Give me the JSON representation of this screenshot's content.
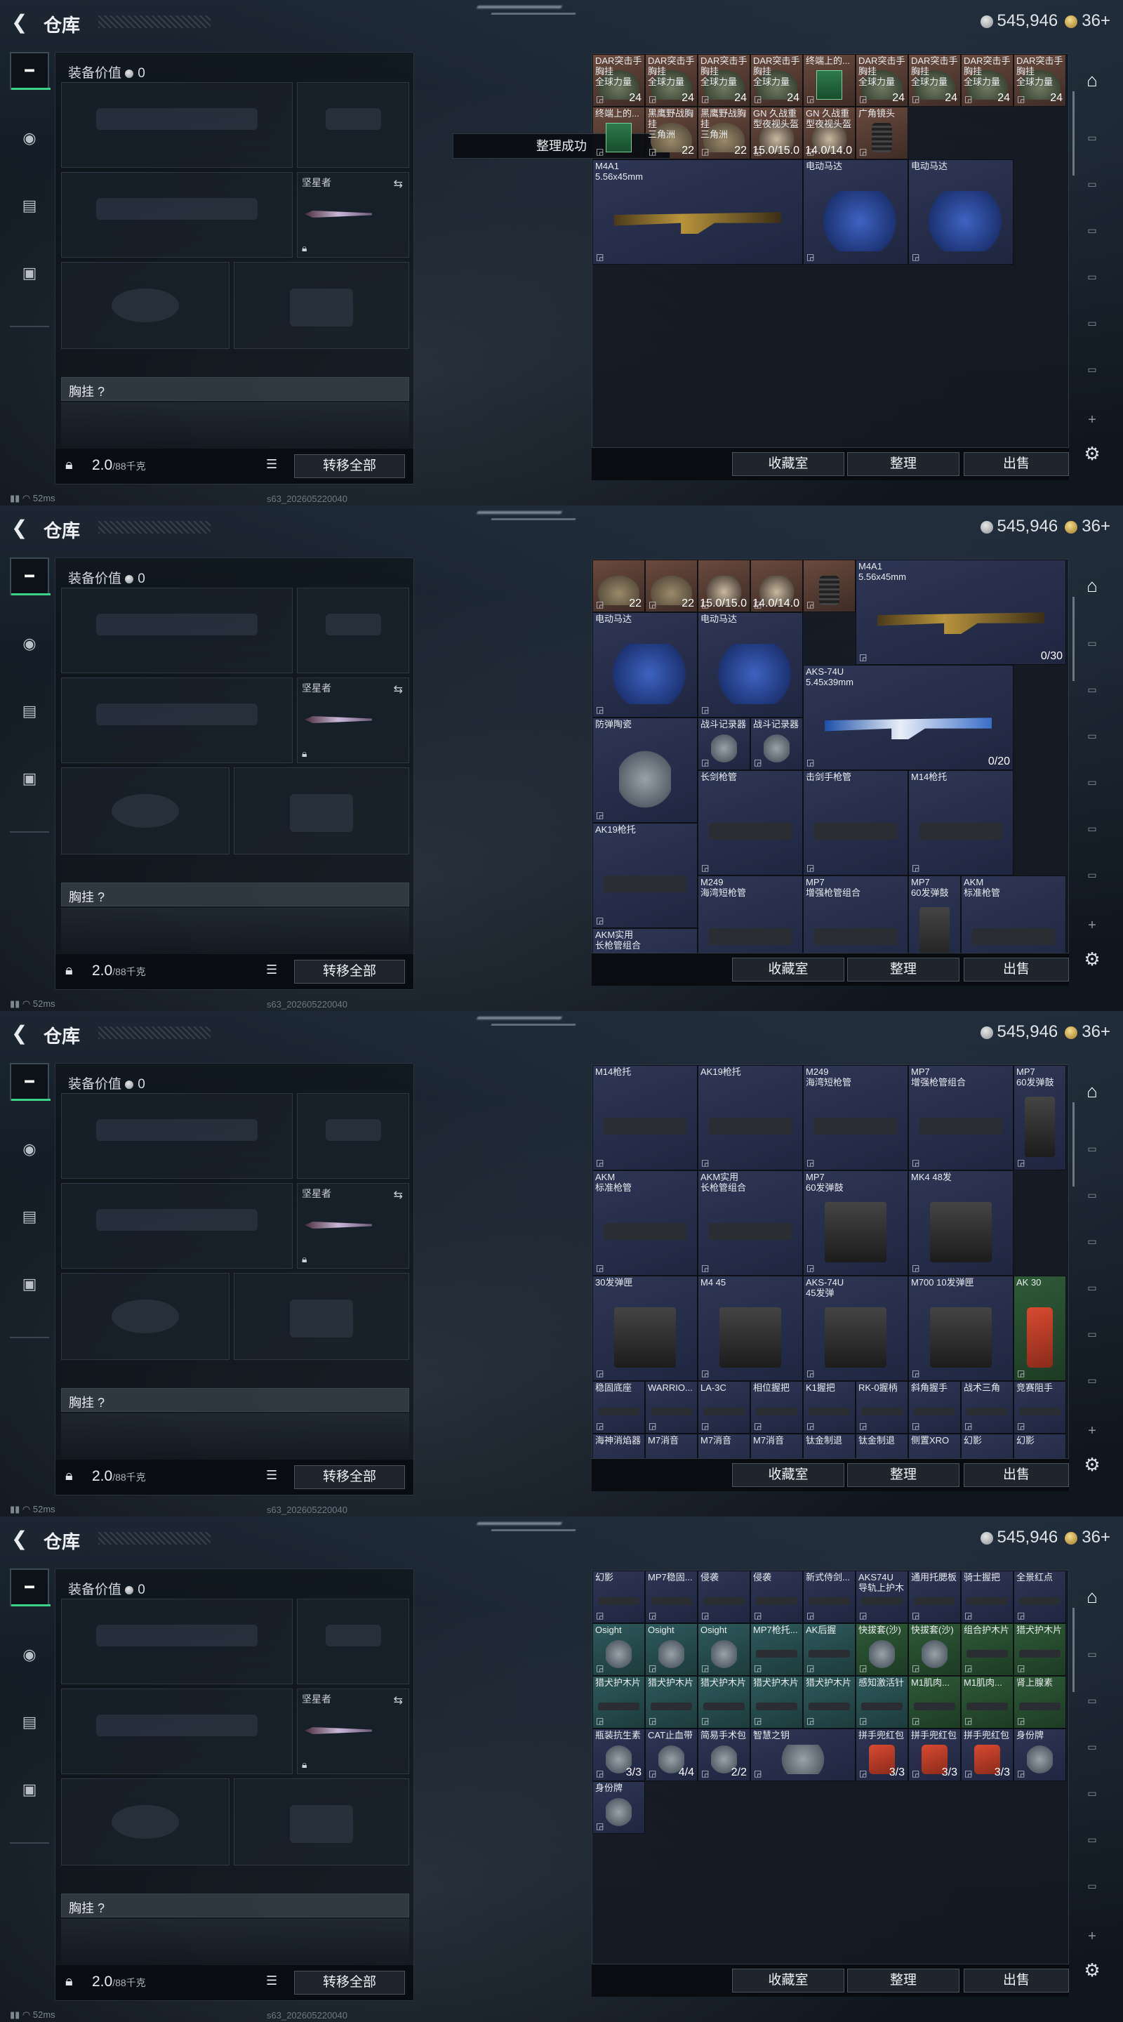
{
  "header": {
    "title": "仓库",
    "silver": "545,946",
    "gold": "36+"
  },
  "equip": {
    "value_label": "装备价值",
    "value": "0",
    "sidearm_label": "坚星者",
    "chest_label": "胸挂",
    "chest_q": "?",
    "weight": "2.0",
    "weight_max": "/88千克",
    "transfer_label": "转移全部"
  },
  "storage_buttons": {
    "collection": "收藏室",
    "sort": "整理",
    "sell": "出售"
  },
  "status": {
    "ping": "52ms",
    "build": "s63_202605220040"
  },
  "toast": "整理成功",
  "panels": [
    {
      "cells": [
        {
          "n": "DAR突击手胸挂\n全球力量",
          "c": "24",
          "k": "brown",
          "p": "bag"
        },
        {
          "n": "DAR突击手胸挂\n全球力量",
          "c": "24",
          "k": "brown",
          "p": "bag"
        },
        {
          "n": "DAR突击手胸挂\n全球力量",
          "c": "24",
          "k": "brown",
          "p": "bag"
        },
        {
          "n": "DAR突击手胸挂\n全球力量",
          "c": "24",
          "k": "brown",
          "p": "bag"
        },
        {
          "n": "终端上的...",
          "c": "",
          "k": "brown",
          "p": "chip"
        },
        {
          "n": "DAR突击手胸挂\n全球力量",
          "c": "24",
          "k": "brown",
          "p": "bag"
        },
        {
          "n": "DAR突击手胸挂\n全球力量",
          "c": "24",
          "k": "brown",
          "p": "bag"
        },
        {
          "n": "DAR突击手胸挂\n全球力量",
          "c": "24",
          "k": "brown",
          "p": "bag"
        },
        {
          "n": "DAR突击手胸挂\n全球力量",
          "c": "24",
          "k": "brown",
          "p": "bag"
        },
        {
          "n": "终端上的...",
          "c": "",
          "k": "brown",
          "p": "chip"
        },
        {
          "n": "黑鹰野战胸挂\n三角洲",
          "c": "22",
          "k": "brown",
          "p": "bag2"
        },
        {
          "n": "黑鹰野战胸挂\n三角洲",
          "c": "22",
          "k": "brown",
          "p": "bag2"
        },
        {
          "n": "GN 久战重型夜视头盔",
          "c": "15.0/15.0",
          "k": "brown",
          "p": "helmet"
        },
        {
          "n": "GN 久战重型夜视头盔",
          "c": "14.0/14.0",
          "k": "brown",
          "p": "helmet"
        },
        {
          "n": "广角镜头",
          "c": "",
          "k": "brown",
          "p": "lens"
        },
        {
          "n": "M4A1\n5.56x45mm",
          "c": "",
          "k": "navy",
          "p": "gungold",
          "span": "big2"
        },
        {
          "n": "电动马达",
          "c": "",
          "k": "navy",
          "p": "motor",
          "span": "wide2"
        },
        {
          "n": "电动马达",
          "c": "",
          "k": "navy",
          "p": "motor",
          "span": "wide2"
        }
      ]
    },
    {
      "cells": [
        {
          "n": "",
          "c": "22",
          "k": "brown",
          "p": "bag2"
        },
        {
          "n": "",
          "c": "22",
          "k": "brown",
          "p": "bag2"
        },
        {
          "n": "",
          "c": "15.0/15.0",
          "k": "brown",
          "p": "helmet"
        },
        {
          "n": "",
          "c": "14.0/14.0",
          "k": "brown",
          "p": "helmet"
        },
        {
          "n": "",
          "c": "",
          "k": "brown",
          "p": "lens"
        },
        {
          "n": "M4A1\n5.56x45mm",
          "c": "0/30",
          "k": "navy",
          "p": "gungold",
          "span": "big2"
        },
        {
          "n": "电动马达",
          "c": "",
          "k": "navy",
          "p": "motor",
          "span": "wide2"
        },
        {
          "n": "电动马达",
          "c": "",
          "k": "navy",
          "p": "motor",
          "span": "wide2"
        },
        {
          "n": "AKS-74U\n5.45x39mm",
          "c": "0/20",
          "k": "navy",
          "p": "gunblue",
          "span": "big2"
        },
        {
          "n": "防弹陶瓷",
          "c": "",
          "k": "navy",
          "p": "item",
          "span": "wide2"
        },
        {
          "n": "战斗记录器",
          "c": "",
          "k": "navy",
          "p": "item"
        },
        {
          "n": "战斗记录器",
          "c": "",
          "k": "navy",
          "p": "item"
        },
        {
          "n": "长剑枪管",
          "c": "",
          "k": "navy",
          "p": "part",
          "span": "wide2"
        },
        {
          "n": "击剑手枪管",
          "c": "",
          "k": "navy",
          "p": "part",
          "span": "wide2"
        },
        {
          "n": "M14枪托",
          "c": "",
          "k": "navy",
          "p": "part",
          "span": "wide2"
        },
        {
          "n": "AK19枪托",
          "c": "",
          "k": "navy",
          "p": "part",
          "span": "wide2"
        },
        {
          "n": "M249\n海湾短枪管",
          "c": "",
          "k": "navy",
          "p": "part",
          "span": "wide2"
        },
        {
          "n": "MP7\n增强枪管组合",
          "c": "",
          "k": "navy",
          "p": "part",
          "span": "wide2"
        },
        {
          "n": "MP7\n60发弹鼓",
          "c": "",
          "k": "navy",
          "p": "mag",
          "span": "tall"
        },
        {
          "n": "AKM\n标准枪管",
          "c": "",
          "k": "navy",
          "p": "part",
          "span": "wide2"
        },
        {
          "n": "AKM实用\n长枪管组合",
          "c": "",
          "k": "navy",
          "p": "part",
          "span": "wide2"
        },
        {
          "n": "MP7\n60发弹鼓",
          "c": "",
          "k": "navy",
          "p": "mag",
          "span": "wide2"
        },
        {
          "n": "MK4 48发",
          "c": "",
          "k": "navy",
          "p": "mag",
          "span": "wide2"
        },
        {
          "n": "30发弹匣",
          "c": "",
          "k": "navy",
          "p": "mag",
          "span": "wide2"
        },
        {
          "n": "M4 45",
          "c": "",
          "k": "navy",
          "p": "mag",
          "span": "wide2"
        },
        {
          "n": "AKS-74U",
          "c": "",
          "k": "navy",
          "p": "mag",
          "span": "wide2"
        },
        {
          "n": "M700 10发弹匣",
          "c": "",
          "k": "navy",
          "p": "mag",
          "span": "wide2"
        },
        {
          "n": "AK 30",
          "c": "",
          "k": "navy",
          "p": "red"
        }
      ]
    },
    {
      "cells": [
        {
          "n": "M14枪托",
          "c": "",
          "k": "navy",
          "p": "part",
          "span": "wide2"
        },
        {
          "n": "AK19枪托",
          "c": "",
          "k": "navy",
          "p": "part",
          "span": "wide2"
        },
        {
          "n": "M249\n海湾短枪管",
          "c": "",
          "k": "navy",
          "p": "part",
          "span": "wide2"
        },
        {
          "n": "MP7\n增强枪管组合",
          "c": "",
          "k": "navy",
          "p": "part",
          "span": "wide2"
        },
        {
          "n": "MP7\n60发弹鼓",
          "c": "",
          "k": "navy",
          "p": "mag",
          "span": "tall"
        },
        {
          "n": "AKM\n标准枪管",
          "c": "",
          "k": "navy",
          "p": "part",
          "span": "wide2"
        },
        {
          "n": "AKM实用\n长枪管组合",
          "c": "",
          "k": "navy",
          "p": "part",
          "span": "wide2"
        },
        {
          "n": "MP7\n60发弹鼓",
          "c": "",
          "k": "navy",
          "p": "mag",
          "span": "wide2"
        },
        {
          "n": "MK4 48发",
          "c": "",
          "k": "navy",
          "p": "mag",
          "span": "wide2"
        },
        {
          "n": "30发弹匣",
          "c": "",
          "k": "navy",
          "p": "mag",
          "span": "wide2"
        },
        {
          "n": "M4 45",
          "c": "",
          "k": "navy",
          "p": "mag",
          "span": "wide2"
        },
        {
          "n": "AKS-74U\n45发弹",
          "c": "",
          "k": "navy",
          "p": "mag",
          "span": "wide2"
        },
        {
          "n": "M700 10发弹匣",
          "c": "",
          "k": "navy",
          "p": "mag",
          "span": "wide2"
        },
        {
          "n": "AK 30",
          "c": "",
          "k": "green",
          "p": "red",
          "span": "tall"
        },
        {
          "n": "稳固底座",
          "c": "",
          "k": "navy",
          "p": "part"
        },
        {
          "n": "WARRIO...",
          "c": "",
          "k": "navy",
          "p": "part"
        },
        {
          "n": "LA-3C",
          "c": "",
          "k": "navy",
          "p": "part"
        },
        {
          "n": "相位握把",
          "c": "",
          "k": "navy",
          "p": "part"
        },
        {
          "n": "K1握把",
          "c": "",
          "k": "navy",
          "p": "part"
        },
        {
          "n": "RK-0握柄",
          "c": "",
          "k": "navy",
          "p": "part"
        },
        {
          "n": "斜角握手",
          "c": "",
          "k": "navy",
          "p": "part"
        },
        {
          "n": "战术三角",
          "c": "",
          "k": "navy",
          "p": "part"
        },
        {
          "n": "竞赛阻手",
          "c": "",
          "k": "navy",
          "p": "part"
        },
        {
          "n": "海神消焰器",
          "c": "",
          "k": "navy",
          "p": "part"
        },
        {
          "n": "M7消音",
          "c": "",
          "k": "navy",
          "p": "part"
        },
        {
          "n": "M7消音",
          "c": "",
          "k": "navy",
          "p": "part"
        },
        {
          "n": "M7消音",
          "c": "",
          "k": "navy",
          "p": "part"
        },
        {
          "n": "钛金制退",
          "c": "",
          "k": "navy",
          "p": "part"
        },
        {
          "n": "钛金制退",
          "c": "",
          "k": "navy",
          "p": "part"
        },
        {
          "n": "侧置XRO",
          "c": "",
          "k": "navy",
          "p": "part"
        },
        {
          "n": "幻影",
          "c": "",
          "k": "navy",
          "p": "part"
        },
        {
          "n": "幻影",
          "c": "",
          "k": "navy",
          "p": "part"
        },
        {
          "n": "MP7稳固...",
          "c": "",
          "k": "navy",
          "p": "part"
        },
        {
          "n": "侵袭",
          "c": "",
          "k": "navy",
          "p": "part"
        },
        {
          "n": "侵袭",
          "c": "",
          "k": "navy",
          "p": "part"
        },
        {
          "n": "新式侍剑...",
          "c": "",
          "k": "navy",
          "p": "part"
        },
        {
          "n": "AKS74U\n导轨上护木",
          "c": "",
          "k": "navy",
          "p": "part"
        },
        {
          "n": "通用托腮板",
          "c": "",
          "k": "navy",
          "p": "part"
        },
        {
          "n": "骑士握把",
          "c": "",
          "k": "navy",
          "p": "tri"
        },
        {
          "n": "全景红点",
          "c": "",
          "k": "navy",
          "p": "tri"
        },
        {
          "n": "Osight",
          "c": "",
          "k": "teal",
          "p": "tri"
        },
        {
          "n": "Osight",
          "c": "",
          "k": "teal",
          "p": "tri"
        },
        {
          "n": "Osight",
          "c": "",
          "k": "teal",
          "p": "tri"
        },
        {
          "n": "MP7枪托...",
          "c": "",
          "k": "teal",
          "p": "tri"
        },
        {
          "n": "AK后握",
          "c": "",
          "k": "teal",
          "p": "tri"
        },
        {
          "n": "快拔套(沙)",
          "c": "",
          "k": "green",
          "p": "tri"
        },
        {
          "n": "快拔套(沙)",
          "c": "",
          "k": "green",
          "p": "tri"
        },
        {
          "n": "组合护木片",
          "c": "",
          "k": "green",
          "p": "tri"
        },
        {
          "n": "猎犬护木片",
          "c": "",
          "k": "green",
          "p": "tri"
        }
      ]
    },
    {
      "cells": [
        {
          "n": "幻影",
          "c": "",
          "k": "navy",
          "p": "part"
        },
        {
          "n": "MP7稳固...",
          "c": "",
          "k": "navy",
          "p": "part"
        },
        {
          "n": "侵袭",
          "c": "",
          "k": "navy",
          "p": "part"
        },
        {
          "n": "侵袭",
          "c": "",
          "k": "navy",
          "p": "part"
        },
        {
          "n": "新式侍剑...",
          "c": "",
          "k": "navy",
          "p": "part"
        },
        {
          "n": "AKS74U\n导轨上护木",
          "c": "",
          "k": "navy",
          "p": "part"
        },
        {
          "n": "通用托腮板",
          "c": "",
          "k": "navy",
          "p": "part"
        },
        {
          "n": "骑士握把",
          "c": "",
          "k": "navy",
          "p": "part"
        },
        {
          "n": "全景红点",
          "c": "",
          "k": "navy",
          "p": "part"
        },
        {
          "n": "Osight",
          "c": "",
          "k": "teal",
          "p": "item"
        },
        {
          "n": "Osight",
          "c": "",
          "k": "teal",
          "p": "item"
        },
        {
          "n": "Osight",
          "c": "",
          "k": "teal",
          "p": "item"
        },
        {
          "n": "MP7枪托...",
          "c": "",
          "k": "teal",
          "p": "part"
        },
        {
          "n": "AK后握",
          "c": "",
          "k": "teal",
          "p": "part"
        },
        {
          "n": "快拔套(沙)",
          "c": "",
          "k": "green",
          "p": "item"
        },
        {
          "n": "快拔套(沙)",
          "c": "",
          "k": "green",
          "p": "item"
        },
        {
          "n": "组合护木片",
          "c": "",
          "k": "green",
          "p": "part"
        },
        {
          "n": "猎犬护木片",
          "c": "",
          "k": "green",
          "p": "part"
        },
        {
          "n": "猎犬护木片",
          "c": "",
          "k": "teal",
          "p": "part"
        },
        {
          "n": "猎犬护木片",
          "c": "",
          "k": "teal",
          "p": "part"
        },
        {
          "n": "猎犬护木片",
          "c": "",
          "k": "teal",
          "p": "part"
        },
        {
          "n": "猎犬护木片",
          "c": "",
          "k": "teal",
          "p": "part"
        },
        {
          "n": "猎犬护木片",
          "c": "",
          "k": "teal",
          "p": "part"
        },
        {
          "n": "感知激活针",
          "c": "",
          "k": "teal",
          "p": "part"
        },
        {
          "n": "M1肌肉...",
          "c": "",
          "k": "green",
          "p": "part"
        },
        {
          "n": "M1肌肉...",
          "c": "",
          "k": "green",
          "p": "part"
        },
        {
          "n": "肾上腺素",
          "c": "",
          "k": "green",
          "p": "part"
        },
        {
          "n": "瓶装抗生素",
          "c": "3/3",
          "k": "navy",
          "p": "item"
        },
        {
          "n": "CAT止血带",
          "c": "4/4",
          "k": "navy",
          "p": "item"
        },
        {
          "n": "简易手术包",
          "c": "2/2",
          "k": "navy",
          "p": "item"
        },
        {
          "n": "智慧之钥",
          "c": "",
          "k": "navy",
          "p": "item",
          "span": "wide2h"
        },
        {
          "n": "拼手兜红包",
          "c": "3/3",
          "k": "navy",
          "p": "red"
        },
        {
          "n": "拼手兜红包",
          "c": "3/3",
          "k": "navy",
          "p": "red"
        },
        {
          "n": "拼手兜红包",
          "c": "3/3",
          "k": "navy",
          "p": "red"
        },
        {
          "n": "身份牌",
          "c": "",
          "k": "navy",
          "p": "item"
        },
        {
          "n": "身份牌",
          "c": "",
          "k": "navy",
          "p": "item"
        }
      ]
    }
  ]
}
